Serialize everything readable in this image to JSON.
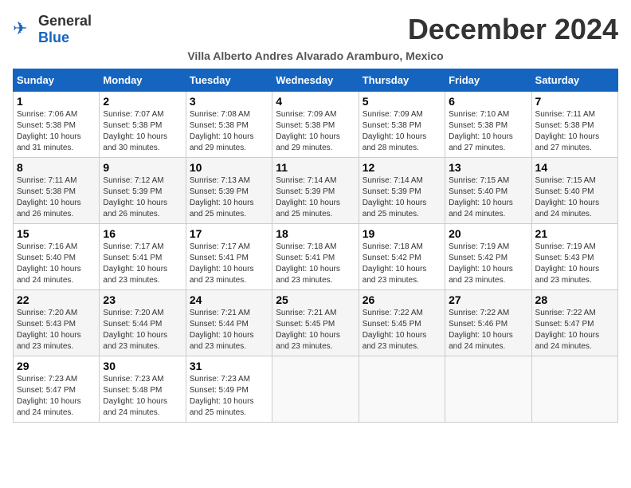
{
  "logo": {
    "general": "General",
    "blue": "Blue"
  },
  "title": "December 2024",
  "subtitle": "Villa Alberto Andres Alvarado Aramburo, Mexico",
  "days_of_week": [
    "Sunday",
    "Monday",
    "Tuesday",
    "Wednesday",
    "Thursday",
    "Friday",
    "Saturday"
  ],
  "weeks": [
    [
      {
        "day": "1",
        "sunrise": "7:06 AM",
        "sunset": "5:38 PM",
        "daylight": "10 hours and 31 minutes."
      },
      {
        "day": "2",
        "sunrise": "7:07 AM",
        "sunset": "5:38 PM",
        "daylight": "10 hours and 30 minutes."
      },
      {
        "day": "3",
        "sunrise": "7:08 AM",
        "sunset": "5:38 PM",
        "daylight": "10 hours and 29 minutes."
      },
      {
        "day": "4",
        "sunrise": "7:09 AM",
        "sunset": "5:38 PM",
        "daylight": "10 hours and 29 minutes."
      },
      {
        "day": "5",
        "sunrise": "7:09 AM",
        "sunset": "5:38 PM",
        "daylight": "10 hours and 28 minutes."
      },
      {
        "day": "6",
        "sunrise": "7:10 AM",
        "sunset": "5:38 PM",
        "daylight": "10 hours and 27 minutes."
      },
      {
        "day": "7",
        "sunrise": "7:11 AM",
        "sunset": "5:38 PM",
        "daylight": "10 hours and 27 minutes."
      }
    ],
    [
      {
        "day": "8",
        "sunrise": "7:11 AM",
        "sunset": "5:38 PM",
        "daylight": "10 hours and 26 minutes."
      },
      {
        "day": "9",
        "sunrise": "7:12 AM",
        "sunset": "5:39 PM",
        "daylight": "10 hours and 26 minutes."
      },
      {
        "day": "10",
        "sunrise": "7:13 AM",
        "sunset": "5:39 PM",
        "daylight": "10 hours and 25 minutes."
      },
      {
        "day": "11",
        "sunrise": "7:14 AM",
        "sunset": "5:39 PM",
        "daylight": "10 hours and 25 minutes."
      },
      {
        "day": "12",
        "sunrise": "7:14 AM",
        "sunset": "5:39 PM",
        "daylight": "10 hours and 25 minutes."
      },
      {
        "day": "13",
        "sunrise": "7:15 AM",
        "sunset": "5:40 PM",
        "daylight": "10 hours and 24 minutes."
      },
      {
        "day": "14",
        "sunrise": "7:15 AM",
        "sunset": "5:40 PM",
        "daylight": "10 hours and 24 minutes."
      }
    ],
    [
      {
        "day": "15",
        "sunrise": "7:16 AM",
        "sunset": "5:40 PM",
        "daylight": "10 hours and 24 minutes."
      },
      {
        "day": "16",
        "sunrise": "7:17 AM",
        "sunset": "5:41 PM",
        "daylight": "10 hours and 23 minutes."
      },
      {
        "day": "17",
        "sunrise": "7:17 AM",
        "sunset": "5:41 PM",
        "daylight": "10 hours and 23 minutes."
      },
      {
        "day": "18",
        "sunrise": "7:18 AM",
        "sunset": "5:41 PM",
        "daylight": "10 hours and 23 minutes."
      },
      {
        "day": "19",
        "sunrise": "7:18 AM",
        "sunset": "5:42 PM",
        "daylight": "10 hours and 23 minutes."
      },
      {
        "day": "20",
        "sunrise": "7:19 AM",
        "sunset": "5:42 PM",
        "daylight": "10 hours and 23 minutes."
      },
      {
        "day": "21",
        "sunrise": "7:19 AM",
        "sunset": "5:43 PM",
        "daylight": "10 hours and 23 minutes."
      }
    ],
    [
      {
        "day": "22",
        "sunrise": "7:20 AM",
        "sunset": "5:43 PM",
        "daylight": "10 hours and 23 minutes."
      },
      {
        "day": "23",
        "sunrise": "7:20 AM",
        "sunset": "5:44 PM",
        "daylight": "10 hours and 23 minutes."
      },
      {
        "day": "24",
        "sunrise": "7:21 AM",
        "sunset": "5:44 PM",
        "daylight": "10 hours and 23 minutes."
      },
      {
        "day": "25",
        "sunrise": "7:21 AM",
        "sunset": "5:45 PM",
        "daylight": "10 hours and 23 minutes."
      },
      {
        "day": "26",
        "sunrise": "7:22 AM",
        "sunset": "5:45 PM",
        "daylight": "10 hours and 23 minutes."
      },
      {
        "day": "27",
        "sunrise": "7:22 AM",
        "sunset": "5:46 PM",
        "daylight": "10 hours and 24 minutes."
      },
      {
        "day": "28",
        "sunrise": "7:22 AM",
        "sunset": "5:47 PM",
        "daylight": "10 hours and 24 minutes."
      }
    ],
    [
      {
        "day": "29",
        "sunrise": "7:23 AM",
        "sunset": "5:47 PM",
        "daylight": "10 hours and 24 minutes."
      },
      {
        "day": "30",
        "sunrise": "7:23 AM",
        "sunset": "5:48 PM",
        "daylight": "10 hours and 24 minutes."
      },
      {
        "day": "31",
        "sunrise": "7:23 AM",
        "sunset": "5:49 PM",
        "daylight": "10 hours and 25 minutes."
      },
      null,
      null,
      null,
      null
    ]
  ],
  "labels": {
    "sunrise": "Sunrise:",
    "sunset": "Sunset:",
    "daylight": "Daylight: "
  }
}
